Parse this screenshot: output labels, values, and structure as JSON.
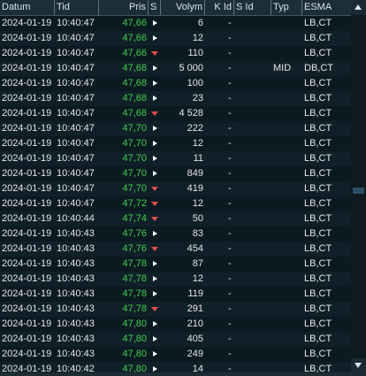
{
  "columns": {
    "date": "Datum",
    "time": "Tid",
    "price": "Pris",
    "side": "S",
    "volume": "Volym",
    "kid": "K Id",
    "sid": "S Id",
    "type": "Typ",
    "esma": "ESMA"
  },
  "rows": [
    {
      "date": "2024-01-19",
      "time": "10:40:47",
      "price": "47,66",
      "side": "right",
      "volume": "6",
      "kid": "- -",
      "sid": "",
      "type": "",
      "esma": "LB,CT"
    },
    {
      "date": "2024-01-19",
      "time": "10:40:47",
      "price": "47,66",
      "side": "right",
      "volume": "12",
      "kid": "- -",
      "sid": "",
      "type": "",
      "esma": "LB,CT"
    },
    {
      "date": "2024-01-19",
      "time": "10:40:47",
      "price": "47,66",
      "side": "down",
      "volume": "110",
      "kid": "- -",
      "sid": "",
      "type": "",
      "esma": "LB,CT"
    },
    {
      "date": "2024-01-19",
      "time": "10:40:47",
      "price": "47,68",
      "side": "right",
      "volume": "5 000",
      "kid": "- -",
      "sid": "",
      "type": "MID",
      "esma": "DB,CT"
    },
    {
      "date": "2024-01-19",
      "time": "10:40:47",
      "price": "47,68",
      "side": "right",
      "volume": "100",
      "kid": "- -",
      "sid": "",
      "type": "",
      "esma": "LB,CT"
    },
    {
      "date": "2024-01-19",
      "time": "10:40:47",
      "price": "47,68",
      "side": "right",
      "volume": "23",
      "kid": "- -",
      "sid": "",
      "type": "",
      "esma": "LB,CT"
    },
    {
      "date": "2024-01-19",
      "time": "10:40:47",
      "price": "47,68",
      "side": "down",
      "volume": "4 528",
      "kid": "- -",
      "sid": "",
      "type": "",
      "esma": "LB,CT"
    },
    {
      "date": "2024-01-19",
      "time": "10:40:47",
      "price": "47,70",
      "side": "right",
      "volume": "222",
      "kid": "- -",
      "sid": "",
      "type": "",
      "esma": "LB,CT"
    },
    {
      "date": "2024-01-19",
      "time": "10:40:47",
      "price": "47,70",
      "side": "right",
      "volume": "12",
      "kid": "- -",
      "sid": "",
      "type": "",
      "esma": "LB,CT"
    },
    {
      "date": "2024-01-19",
      "time": "10:40:47",
      "price": "47,70",
      "side": "right",
      "volume": "11",
      "kid": "- -",
      "sid": "",
      "type": "",
      "esma": "LB,CT"
    },
    {
      "date": "2024-01-19",
      "time": "10:40:47",
      "price": "47,70",
      "side": "right",
      "volume": "849",
      "kid": "- -",
      "sid": "",
      "type": "",
      "esma": "LB,CT"
    },
    {
      "date": "2024-01-19",
      "time": "10:40:47",
      "price": "47,70",
      "side": "down",
      "volume": "419",
      "kid": "- -",
      "sid": "",
      "type": "",
      "esma": "LB,CT"
    },
    {
      "date": "2024-01-19",
      "time": "10:40:47",
      "price": "47,72",
      "side": "down",
      "volume": "12",
      "kid": "- -",
      "sid": "",
      "type": "",
      "esma": "LB,CT"
    },
    {
      "date": "2024-01-19",
      "time": "10:40:44",
      "price": "47,74",
      "side": "down",
      "volume": "50",
      "kid": "- -",
      "sid": "",
      "type": "",
      "esma": "LB,CT"
    },
    {
      "date": "2024-01-19",
      "time": "10:40:43",
      "price": "47,76",
      "side": "right",
      "volume": "83",
      "kid": "- -",
      "sid": "",
      "type": "",
      "esma": "LB,CT"
    },
    {
      "date": "2024-01-19",
      "time": "10:40:43",
      "price": "47,76",
      "side": "down",
      "volume": "454",
      "kid": "- -",
      "sid": "",
      "type": "",
      "esma": "LB,CT"
    },
    {
      "date": "2024-01-19",
      "time": "10:40:43",
      "price": "47,78",
      "side": "right",
      "volume": "87",
      "kid": "- -",
      "sid": "",
      "type": "",
      "esma": "LB,CT"
    },
    {
      "date": "2024-01-19",
      "time": "10:40:43",
      "price": "47,78",
      "side": "right",
      "volume": "12",
      "kid": "- -",
      "sid": "",
      "type": "",
      "esma": "LB,CT"
    },
    {
      "date": "2024-01-19",
      "time": "10:40:43",
      "price": "47,78",
      "side": "right",
      "volume": "119",
      "kid": "- -",
      "sid": "",
      "type": "",
      "esma": "LB,CT"
    },
    {
      "date": "2024-01-19",
      "time": "10:40:43",
      "price": "47,78",
      "side": "down",
      "volume": "291",
      "kid": "- -",
      "sid": "",
      "type": "",
      "esma": "LB,CT"
    },
    {
      "date": "2024-01-19",
      "time": "10:40:43",
      "price": "47,80",
      "side": "right",
      "volume": "210",
      "kid": "- -",
      "sid": "",
      "type": "",
      "esma": "LB,CT"
    },
    {
      "date": "2024-01-19",
      "time": "10:40:43",
      "price": "47,80",
      "side": "right",
      "volume": "405",
      "kid": "- -",
      "sid": "",
      "type": "",
      "esma": "LB,CT"
    },
    {
      "date": "2024-01-19",
      "time": "10:40:43",
      "price": "47,80",
      "side": "right",
      "volume": "249",
      "kid": "- -",
      "sid": "",
      "type": "",
      "esma": "LB,CT"
    },
    {
      "date": "2024-01-19",
      "time": "10:40:42",
      "price": "47,80",
      "side": "right",
      "volume": "14",
      "kid": "- -",
      "sid": "",
      "type": "",
      "esma": "LB,CT"
    }
  ],
  "colors": {
    "price_up": "#3fcf4c",
    "sell_marker": "#e64b4b",
    "buy_marker": "#ffffff",
    "header_bg": "#1c2e38",
    "background": "#0d1b22"
  },
  "icons": {
    "buy": "triangle-right-icon",
    "sell": "triangle-down-icon",
    "scroll_up": "scroll-up-arrow-icon",
    "scroll_down": "scroll-down-arrow-icon"
  }
}
